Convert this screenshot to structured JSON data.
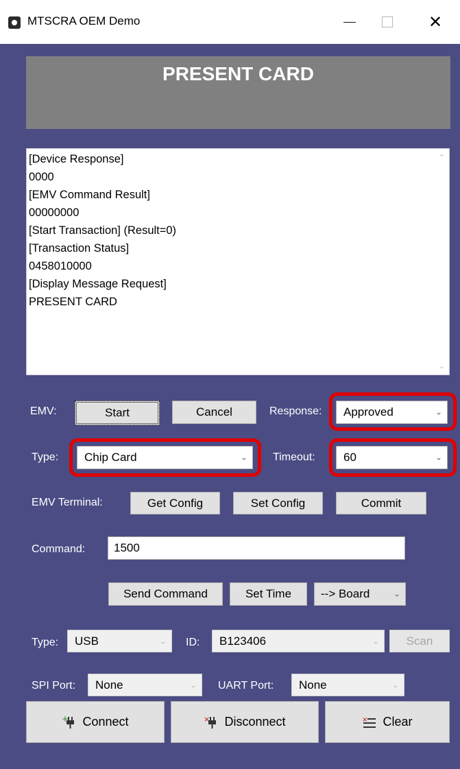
{
  "window": {
    "title": "MTSCRA OEM Demo",
    "minimize": "—",
    "close": "✕"
  },
  "banner": {
    "text": "PRESENT CARD"
  },
  "log": {
    "lines": [
      "[Device Response]",
      "0000",
      "[EMV Command Result]",
      "00000000",
      "[Start Transaction] (Result=0)",
      "[Transaction Status]",
      "0458010000",
      "[Display Message Request]",
      "PRESENT CARD"
    ],
    "scroll_up": "⌃",
    "scroll_down": "⌄"
  },
  "emv": {
    "label": "EMV:",
    "start": "Start",
    "cancel": "Cancel",
    "response_label": "Response:",
    "response_value": "Approved",
    "type_label": "Type:",
    "type_value": "Chip Card",
    "timeout_label": "Timeout:",
    "timeout_value": "60"
  },
  "terminal": {
    "label": "EMV Terminal:",
    "get_config": "Get Config",
    "set_config": "Set Config",
    "commit": "Commit"
  },
  "command": {
    "label": "Command:",
    "value": "1500",
    "send": "Send Command",
    "set_time": "Set Time",
    "target": "--> Board"
  },
  "connection": {
    "type_label": "Type:",
    "type_value": "USB",
    "id_label": "ID:",
    "id_value": "B123406",
    "scan": "Scan"
  },
  "ports": {
    "spi_label": "SPI Port:",
    "spi_value": "None",
    "uart_label": "UART Port:",
    "uart_value": "None"
  },
  "actions": {
    "connect": "Connect",
    "disconnect": "Disconnect",
    "clear": "Clear"
  },
  "icons": {
    "chevron": "chevron-down-icon",
    "connect": "plug-connect-icon",
    "disconnect": "plug-disconnect-icon",
    "clear": "clear-list-icon"
  },
  "colors": {
    "background": "#4b4c84",
    "banner": "#808080",
    "highlight": "#e10000"
  }
}
